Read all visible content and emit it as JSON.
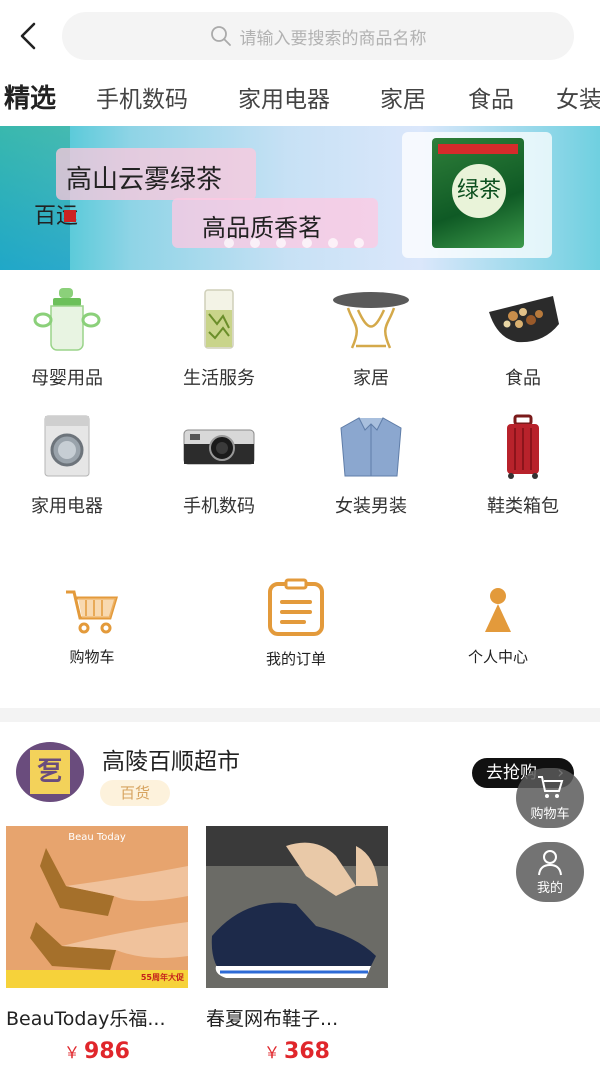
{
  "search": {
    "placeholder": "请输入要搜索的商品名称"
  },
  "tabs": [
    {
      "label": "精选"
    },
    {
      "label": "手机数码"
    },
    {
      "label": "家用电器"
    },
    {
      "label": "家居"
    },
    {
      "label": "食品"
    },
    {
      "label": "女装"
    }
  ],
  "banner": {
    "line1": "高山云雾绿茶",
    "line2": "高品质香茗",
    "brand": "百运",
    "pack_label": "绿茶"
  },
  "categories": [
    {
      "label": "母婴用品",
      "icon": "baby-bottle-icon"
    },
    {
      "label": "生活服务",
      "icon": "tea-glass-icon"
    },
    {
      "label": "家居",
      "icon": "table-icon"
    },
    {
      "label": "食品",
      "icon": "nuts-bowl-icon"
    },
    {
      "label": "家用电器",
      "icon": "washing-machine-icon"
    },
    {
      "label": "手机数码",
      "icon": "camera-icon"
    },
    {
      "label": "女装男装",
      "icon": "shirt-icon"
    },
    {
      "label": "鞋类箱包",
      "icon": "suitcase-icon"
    }
  ],
  "shortcuts": [
    {
      "label": "购物车",
      "icon": "cart-icon"
    },
    {
      "label": "我的订单",
      "icon": "order-icon"
    },
    {
      "label": "个人中心",
      "icon": "profile-icon"
    }
  ],
  "shop": {
    "name": "高陵百顺超市",
    "tag": "百货",
    "buy_label": "去抢购",
    "avatar_text": "乭"
  },
  "products": [
    {
      "name": "BeauToday乐福...",
      "price": "986",
      "currency": "￥",
      "brand_mark": "Beau Today",
      "promo": "55周年大促"
    },
    {
      "name": "春夏网布鞋子...",
      "price": "368",
      "currency": "￥"
    }
  ],
  "floating": {
    "cart_label": "购物车",
    "mine_label": "我的"
  },
  "colors": {
    "price": "#e0262b",
    "accent_orange": "#e39a3b",
    "tag_bg": "#fdf2dc"
  }
}
